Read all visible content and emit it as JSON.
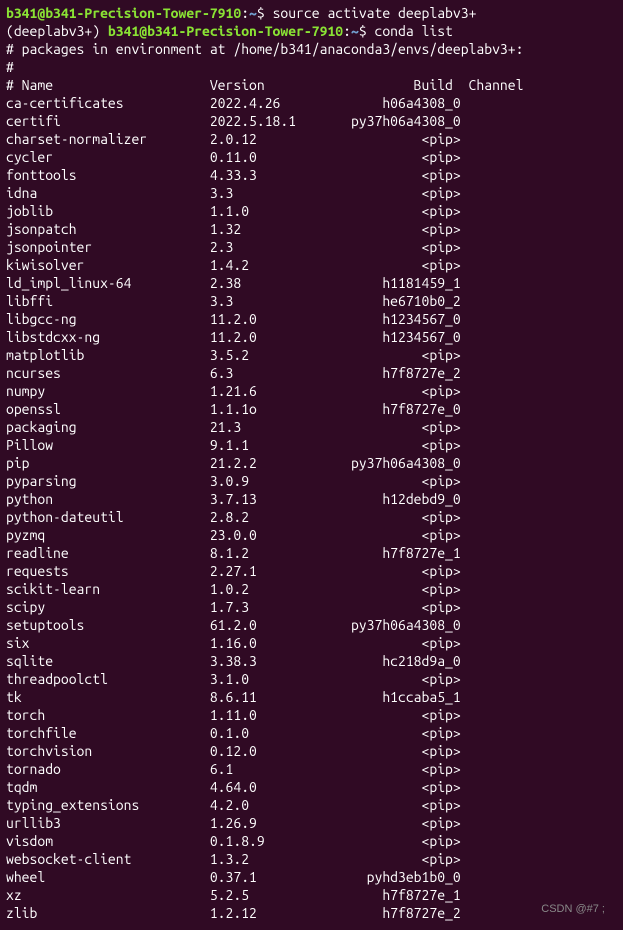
{
  "prompt1": {
    "user_host": "b341@b341-Precision-Tower-7910",
    "path": "~",
    "command": "source activate deeplabv3+"
  },
  "prompt2": {
    "env": "(deeplabv3+) ",
    "user_host": "b341@b341-Precision-Tower-7910",
    "path": "~",
    "command": "conda list"
  },
  "header": {
    "line1": "# packages in environment at /home/b341/anaconda3/envs/deeplabv3+:",
    "line2": "#",
    "columns": "# Name                    Version                   Build  Channel"
  },
  "packages": [
    {
      "name": "ca-certificates",
      "version": "2022.4.26",
      "build": "h06a4308_0"
    },
    {
      "name": "certifi",
      "version": "2022.5.18.1",
      "build": "py37h06a4308_0"
    },
    {
      "name": "charset-normalizer",
      "version": "2.0.12",
      "build": "<pip>"
    },
    {
      "name": "cycler",
      "version": "0.11.0",
      "build": "<pip>"
    },
    {
      "name": "fonttools",
      "version": "4.33.3",
      "build": "<pip>"
    },
    {
      "name": "idna",
      "version": "3.3",
      "build": "<pip>"
    },
    {
      "name": "joblib",
      "version": "1.1.0",
      "build": "<pip>"
    },
    {
      "name": "jsonpatch",
      "version": "1.32",
      "build": "<pip>"
    },
    {
      "name": "jsonpointer",
      "version": "2.3",
      "build": "<pip>"
    },
    {
      "name": "kiwisolver",
      "version": "1.4.2",
      "build": "<pip>"
    },
    {
      "name": "ld_impl_linux-64",
      "version": "2.38",
      "build": "h1181459_1"
    },
    {
      "name": "libffi",
      "version": "3.3",
      "build": "he6710b0_2"
    },
    {
      "name": "libgcc-ng",
      "version": "11.2.0",
      "build": "h1234567_0"
    },
    {
      "name": "libstdcxx-ng",
      "version": "11.2.0",
      "build": "h1234567_0"
    },
    {
      "name": "matplotlib",
      "version": "3.5.2",
      "build": "<pip>"
    },
    {
      "name": "ncurses",
      "version": "6.3",
      "build": "h7f8727e_2"
    },
    {
      "name": "numpy",
      "version": "1.21.6",
      "build": "<pip>"
    },
    {
      "name": "openssl",
      "version": "1.1.1o",
      "build": "h7f8727e_0"
    },
    {
      "name": "packaging",
      "version": "21.3",
      "build": "<pip>"
    },
    {
      "name": "Pillow",
      "version": "9.1.1",
      "build": "<pip>"
    },
    {
      "name": "pip",
      "version": "21.2.2",
      "build": "py37h06a4308_0"
    },
    {
      "name": "pyparsing",
      "version": "3.0.9",
      "build": "<pip>"
    },
    {
      "name": "python",
      "version": "3.7.13",
      "build": "h12debd9_0"
    },
    {
      "name": "python-dateutil",
      "version": "2.8.2",
      "build": "<pip>"
    },
    {
      "name": "pyzmq",
      "version": "23.0.0",
      "build": "<pip>"
    },
    {
      "name": "readline",
      "version": "8.1.2",
      "build": "h7f8727e_1"
    },
    {
      "name": "requests",
      "version": "2.27.1",
      "build": "<pip>"
    },
    {
      "name": "scikit-learn",
      "version": "1.0.2",
      "build": "<pip>"
    },
    {
      "name": "scipy",
      "version": "1.7.3",
      "build": "<pip>"
    },
    {
      "name": "setuptools",
      "version": "61.2.0",
      "build": "py37h06a4308_0"
    },
    {
      "name": "six",
      "version": "1.16.0",
      "build": "<pip>"
    },
    {
      "name": "sqlite",
      "version": "3.38.3",
      "build": "hc218d9a_0"
    },
    {
      "name": "threadpoolctl",
      "version": "3.1.0",
      "build": "<pip>"
    },
    {
      "name": "tk",
      "version": "8.6.11",
      "build": "h1ccaba5_1"
    },
    {
      "name": "torch",
      "version": "1.11.0",
      "build": "<pip>"
    },
    {
      "name": "torchfile",
      "version": "0.1.0",
      "build": "<pip>"
    },
    {
      "name": "torchvision",
      "version": "0.12.0",
      "build": "<pip>"
    },
    {
      "name": "tornado",
      "version": "6.1",
      "build": "<pip>"
    },
    {
      "name": "tqdm",
      "version": "4.64.0",
      "build": "<pip>"
    },
    {
      "name": "typing_extensions",
      "version": "4.2.0",
      "build": "<pip>"
    },
    {
      "name": "urllib3",
      "version": "1.26.9",
      "build": "<pip>"
    },
    {
      "name": "visdom",
      "version": "0.1.8.9",
      "build": "<pip>"
    },
    {
      "name": "websocket-client",
      "version": "1.3.2",
      "build": "<pip>"
    },
    {
      "name": "wheel",
      "version": "0.37.1",
      "build": "pyhd3eb1b0_0"
    },
    {
      "name": "xz",
      "version": "5.2.5",
      "build": "h7f8727e_1"
    },
    {
      "name": "zlib",
      "version": "1.2.12",
      "build": "h7f8727e_2"
    }
  ],
  "watermark": "CSDN @#7 ;"
}
